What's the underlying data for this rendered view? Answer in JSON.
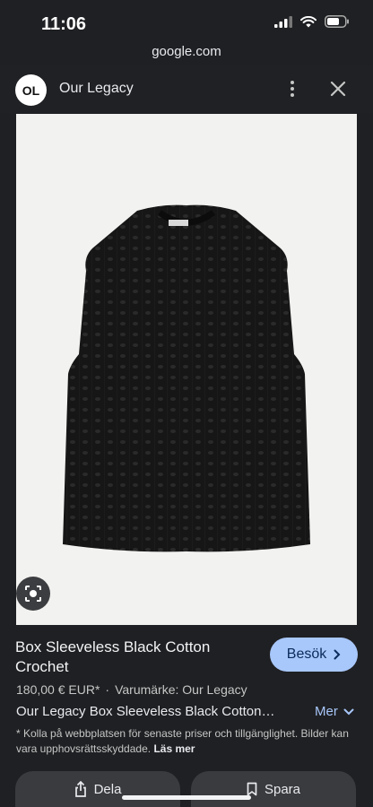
{
  "status_bar": {
    "time": "11:06"
  },
  "browser": {
    "url": "google.com"
  },
  "site": {
    "avatar_text": "OL",
    "name": "Our Legacy"
  },
  "product": {
    "title": "Box Sleeveless Black Cotton Crochet",
    "visit_label": "Besök",
    "price": "180,00 € EUR*",
    "separator": "·",
    "brand": "Varumärke: Our Legacy",
    "description": "Our Legacy Box Sleeveless Black Cotton…",
    "more_label": "Mer",
    "disclaimer": "* Kolla på webbplatsen för senaste priser och tillgänglighet. Bilder kan vara upphovsrättsskyddade.",
    "read_more_label": "Läs mer"
  },
  "actions": {
    "share_label": "Dela",
    "save_label": "Spara"
  },
  "colors": {
    "accent": "#a8c7fa",
    "background": "#1f2023",
    "image_bg": "#f2f2f0",
    "garment": "#1a1a1a"
  },
  "icons": [
    "signal-icon",
    "wifi-icon",
    "battery-icon",
    "more-vert-icon",
    "close-icon",
    "lens-icon",
    "chevron-right-icon",
    "chevron-down-icon",
    "share-icon",
    "bookmark-icon"
  ]
}
